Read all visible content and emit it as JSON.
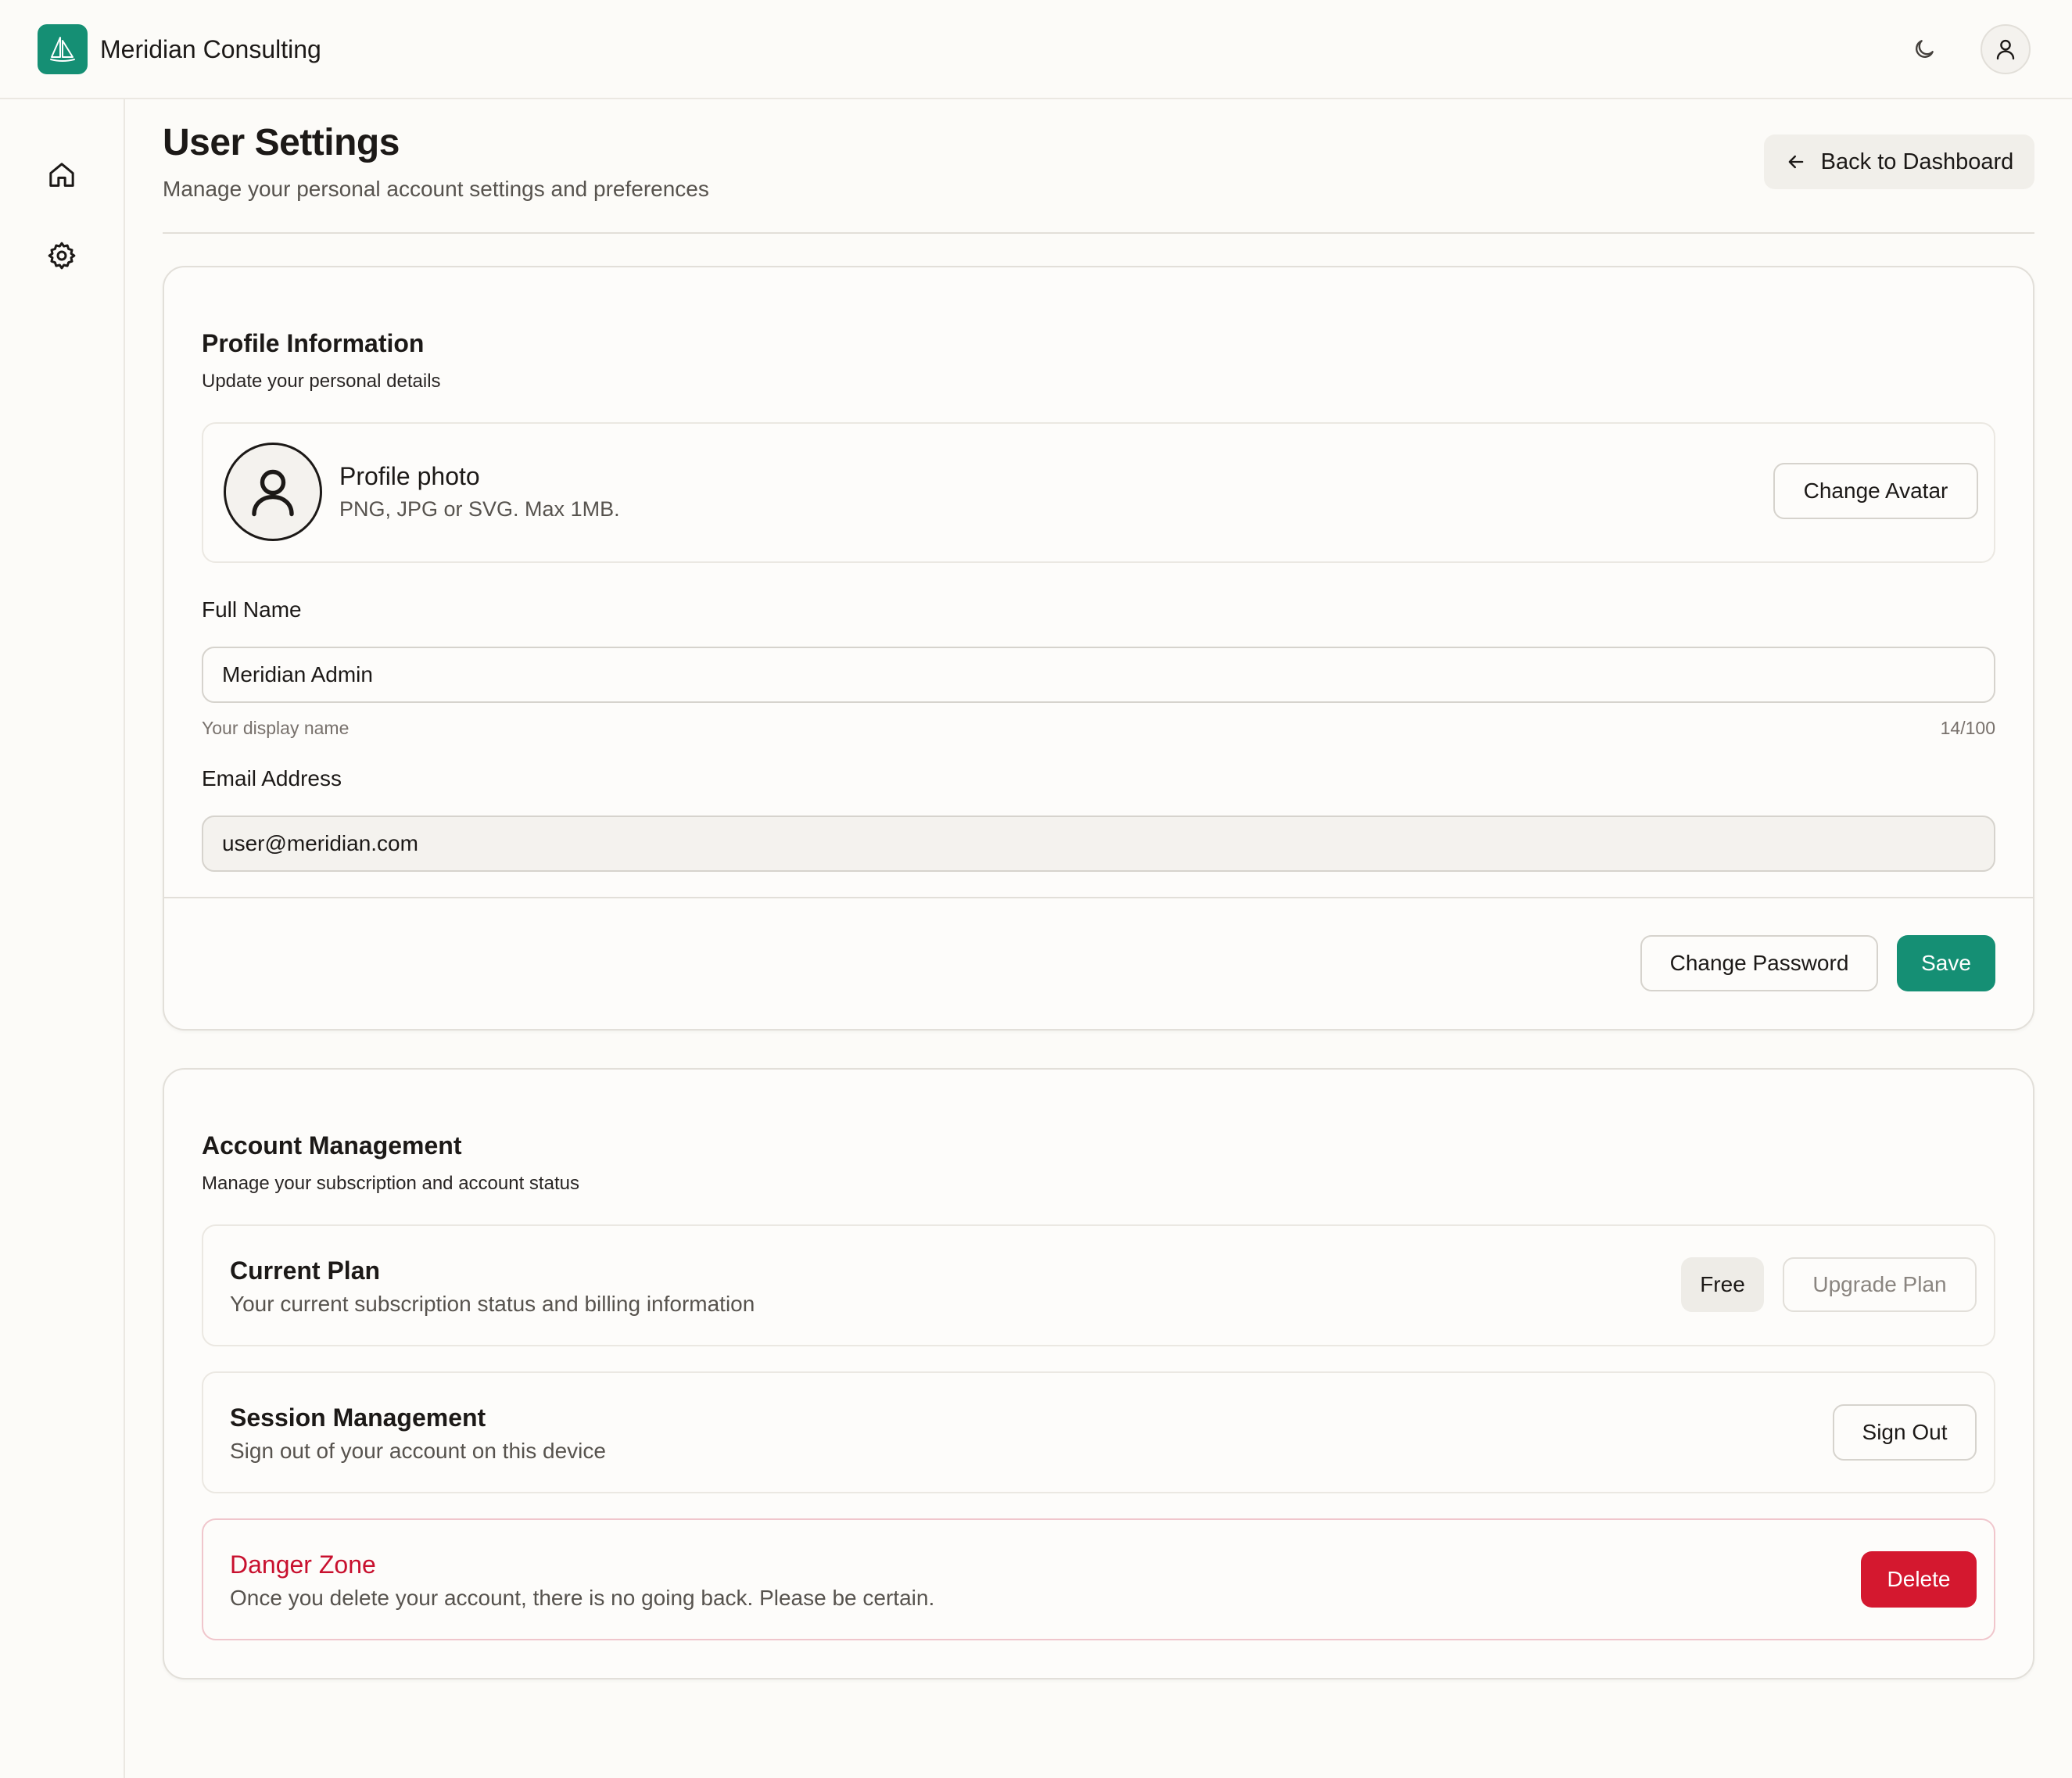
{
  "header": {
    "brand": "Meridian Consulting",
    "logo_icon": "sailboat-icon",
    "theme_icon": "moon-icon",
    "user_icon": "user-icon"
  },
  "sidebar": {
    "items": [
      {
        "name": "home",
        "icon": "home-icon"
      },
      {
        "name": "settings",
        "icon": "gear-icon"
      }
    ]
  },
  "page": {
    "title": "User Settings",
    "subtitle": "Manage your personal account settings and preferences",
    "back_button": "Back to Dashboard"
  },
  "profile": {
    "title": "Profile Information",
    "description": "Update your personal details",
    "photo_title": "Profile photo",
    "photo_desc": "PNG, JPG or SVG. Max 1MB.",
    "change_avatar": "Change Avatar",
    "full_name_label": "Full Name",
    "full_name_value": "Meridian Admin",
    "full_name_hint": "Your display name",
    "full_name_count": "14/100",
    "email_label": "Email Address",
    "email_value": "user@meridian.com",
    "change_password": "Change Password",
    "save": "Save"
  },
  "account": {
    "title": "Account Management",
    "description": "Manage your subscription and account status",
    "plan_title": "Current Plan",
    "plan_desc": "Your current subscription status and billing information",
    "plan_badge": "Free",
    "upgrade": "Upgrade Plan",
    "session_title": "Session Management",
    "session_desc": "Sign out of your account on this device",
    "sign_out": "Sign Out",
    "danger_title": "Danger Zone",
    "danger_desc": "Once you delete your account, there is no going back. Please be certain.",
    "delete": "Delete"
  },
  "colors": {
    "brand": "#158f74",
    "danger": "#d4182f",
    "background": "#fcfbf8"
  }
}
